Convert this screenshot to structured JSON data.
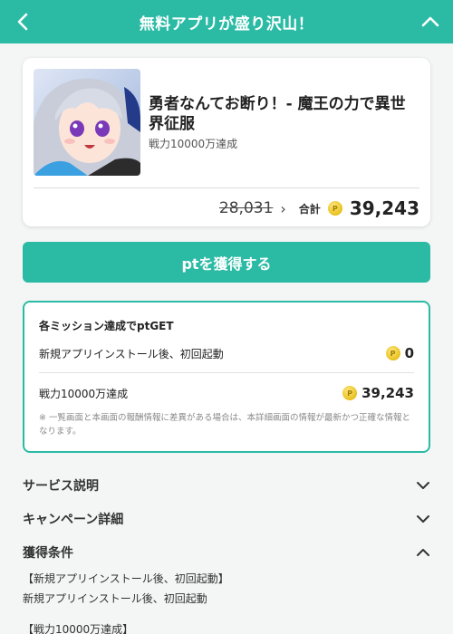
{
  "header": {
    "title": "無料アプリが盛り沢山！",
    "back_icon": "chevron-left-icon",
    "collapse_icon": "chevron-up-icon",
    "color": "#2bbba5"
  },
  "app": {
    "title": "勇者なんてお断り！- 魔王の力で異世界征服",
    "subtitle": "戦力10000万達成",
    "old_price": "28,031",
    "total_label": "合計",
    "total_price": "39,243"
  },
  "get_button": {
    "label": "ptを獲得する"
  },
  "missions": {
    "heading": "各ミッション達成でptGET",
    "items": [
      {
        "label": "新規アプリインストール後、初回起動",
        "reward": "0"
      },
      {
        "label": "戦力10000万達成",
        "reward": "39,243"
      }
    ],
    "note": "※ 一覧画面と本画面の報酬情報に差異がある場合は、本詳細画面の情報が最新かつ正確な情報となります。"
  },
  "sections": [
    {
      "label": "サービス説明",
      "icon": "chevron-down-icon"
    },
    {
      "label": "キャンペーン詳細",
      "icon": "chevron-down-icon"
    },
    {
      "label": "獲得条件",
      "icon": "chevron-up-icon"
    }
  ],
  "conditions": [
    "【新規アプリインストール後、初回起動】",
    "新規アプリインストール後、初回起動",
    "【戦力10000万達成】"
  ],
  "colors": {
    "accent": "#2bbba5",
    "coin": "#e8c11b"
  }
}
